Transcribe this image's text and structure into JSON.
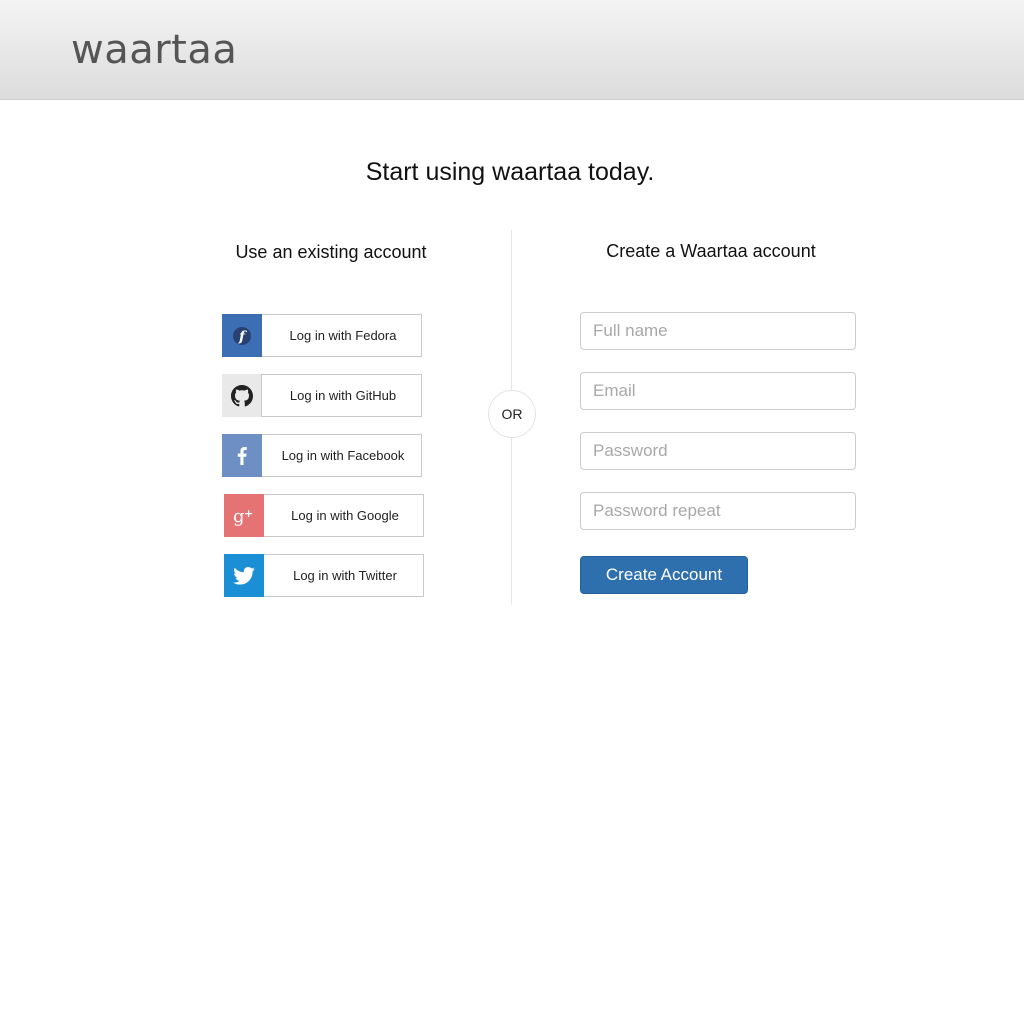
{
  "header": {
    "logo_text": "waartaa"
  },
  "main": {
    "headline": "Start using waartaa today."
  },
  "existing": {
    "title": "Use an existing account",
    "providers": [
      {
        "label": "Log in with Fedora",
        "icon": "fedora-icon",
        "color": "#3c6eb4"
      },
      {
        "label": "Log in with GitHub",
        "icon": "github-icon",
        "color": "#e9e9e9"
      },
      {
        "label": "Log in with Facebook",
        "icon": "facebook-icon",
        "color": "#6d8fc3"
      },
      {
        "label": "Log in with Google",
        "icon": "google-plus-icon",
        "color": "#e57373"
      },
      {
        "label": "Log in with Twitter",
        "icon": "twitter-icon",
        "color": "#1a8fd6"
      }
    ]
  },
  "divider": {
    "or_text": "OR"
  },
  "signup": {
    "title": "Create a Waartaa account",
    "fullname_placeholder": "Full name",
    "email_placeholder": "Email",
    "password_placeholder": "Password",
    "password_repeat_placeholder": "Password repeat",
    "submit_label": "Create Account",
    "accent_color": "#2e6fae"
  }
}
